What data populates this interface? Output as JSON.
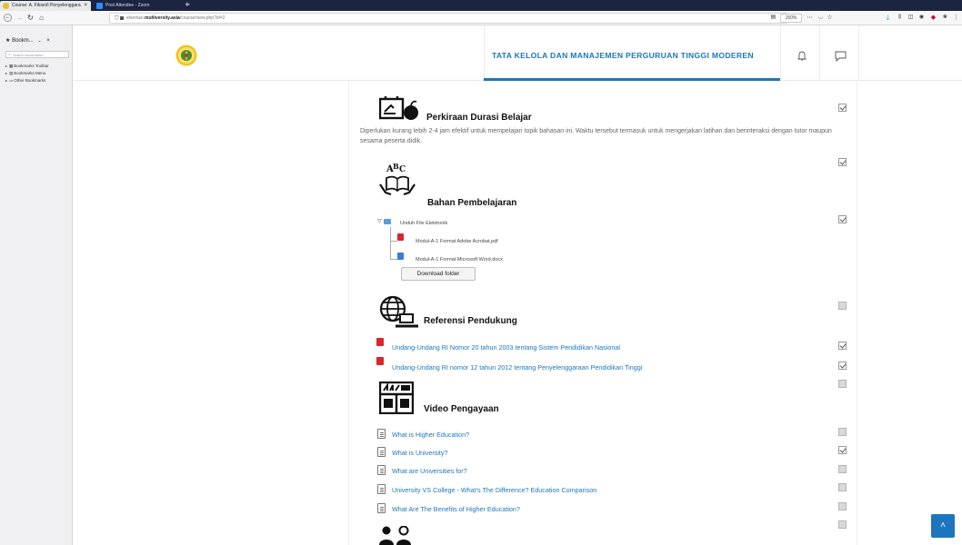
{
  "browser": {
    "tabs": [
      {
        "label": "Course: A. Filosofi Penyelenggara"
      },
      {
        "label": "Post Attendee - Zoom"
      }
    ],
    "url_prefix": "elsertasi.",
    "url_domain": "multiversity.asia",
    "url_path": "/course/view.php?id=2",
    "zoom": "150%",
    "more": "⋯"
  },
  "bookmarks": {
    "title": "Bookm...",
    "search_placeholder": "Search bookmarks",
    "items": [
      {
        "label": "Bookmarks Toolbar"
      },
      {
        "label": "Bookmarks Menu"
      },
      {
        "label": "Other Bookmarks"
      }
    ]
  },
  "header": {
    "title": "TATA KELOLA DAN MANAJEMEN PERGURUAN TINGGI MODEREN"
  },
  "sections": {
    "durasi": {
      "title": "Perkiraan Durasi Belajar",
      "text": "Diperlukan kurang lebih 2-4 jam efektif untuk mempelajari topik bahasan ini. Waktu tersebut termasuk untuk mengerjakan latihan dan berinteraksi dengan tutor maupun sesama peserta didik."
    },
    "bahan": {
      "title": "Bahan Pembelajaran",
      "folder": "Unduh File Elektronik",
      "files": [
        "Modul-A-1 Format Adobe Acrobat.pdf",
        "Modul-A-1 Format Microsoft Word.docx"
      ],
      "download_label": "Download folder"
    },
    "referensi": {
      "title": "Referensi Pendukung",
      "links": [
        "Undang-Undang RI Nomor 20 tahun 2003 tentang Sistem Pendidikan Nasional",
        "Undang-Undang RI nomor 12 tahun 2012 tentang Penyelenggaraan Pendidikan Tinggi"
      ]
    },
    "video": {
      "title": "Video Pengayaan",
      "links": [
        "What is Higher Education?",
        "What is University?",
        "What are Universities for?",
        "University VS College - What's The Difference? Education Comparison",
        "What Are The Benefits of Higher Education?"
      ]
    }
  },
  "completion": [
    true,
    true,
    true,
    false,
    true,
    true,
    false,
    false,
    true,
    false,
    false,
    false,
    false
  ],
  "colors": {
    "accent": "#1d76bd",
    "pdf": "#d9262b"
  }
}
